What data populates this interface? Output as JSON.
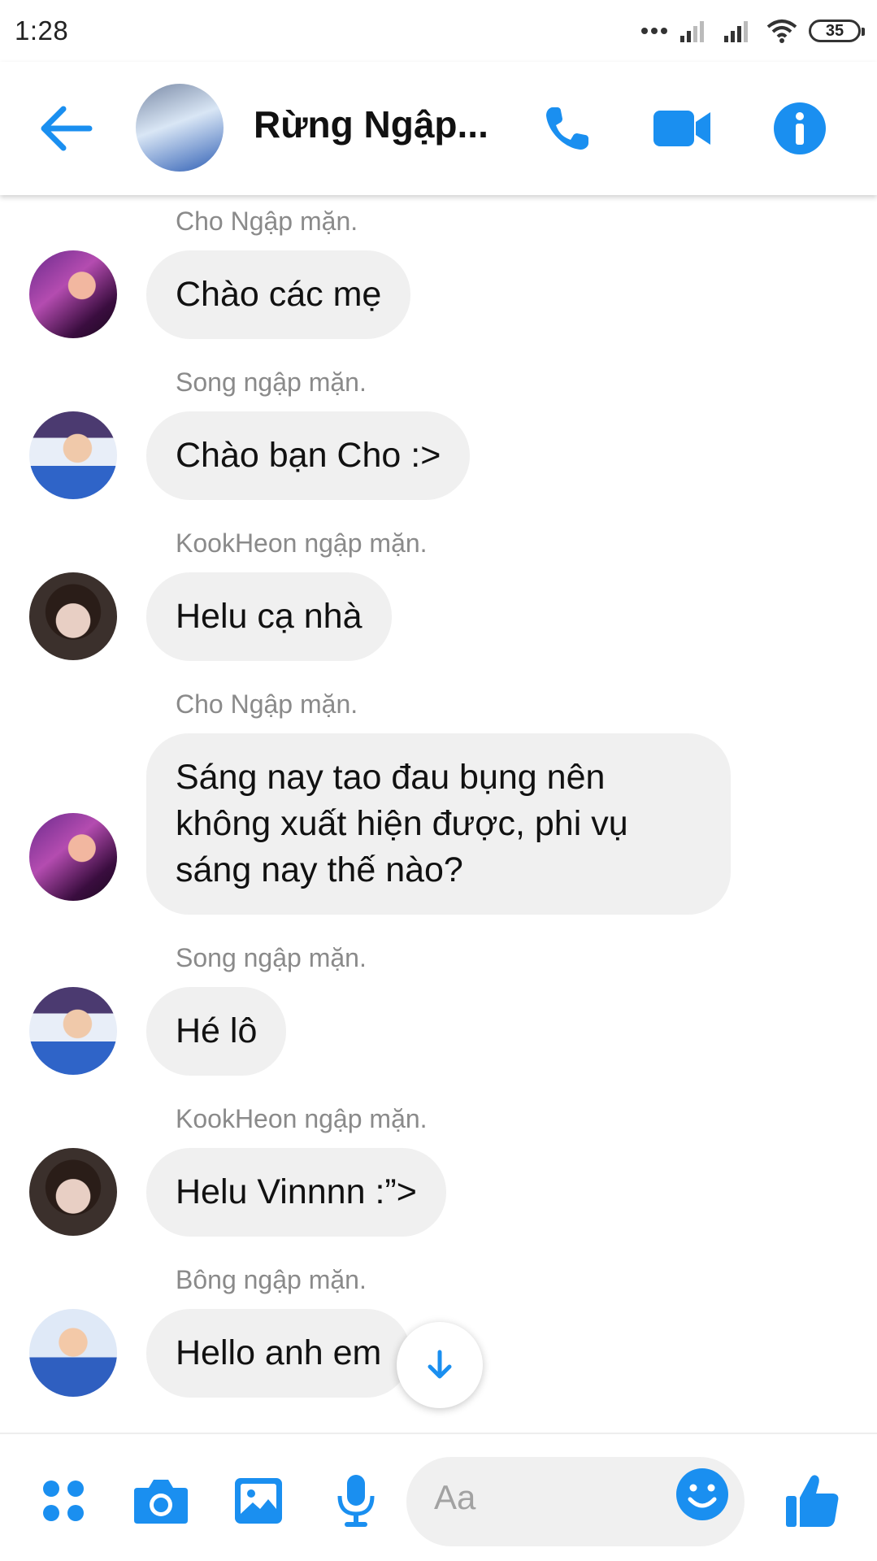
{
  "status_bar": {
    "time": "1:28",
    "battery": "35"
  },
  "header": {
    "title": "Rừng Ngập..."
  },
  "messages": [
    {
      "sender": "Cho Ngập mặn.",
      "text": "Chào các mẹ"
    },
    {
      "sender": "Song ngập mặn.",
      "text": "Chào bạn Cho :>"
    },
    {
      "sender": "KookHeon ngập mặn.",
      "text": "Helu cạ nhà"
    },
    {
      "sender": "Cho Ngập mặn.",
      "lines": [
        "Sáng nay tao đau bụng nên",
        "không xuất hiện được, phi vụ",
        "sáng nay thế nào?"
      ]
    },
    {
      "sender": "Song ngập mặn.",
      "text": "Hé lô"
    },
    {
      "sender": "KookHeon ngập mặn.",
      "text": "Helu Vinnnn :”>"
    },
    {
      "sender": "Bông ngập mặn.",
      "text": "Hello anh em"
    }
  ],
  "composer": {
    "placeholder": "Aa"
  },
  "colors": {
    "accent": "#1a8ff0",
    "bubble": "#f0f0f0",
    "sender": "#8a8a8a"
  }
}
